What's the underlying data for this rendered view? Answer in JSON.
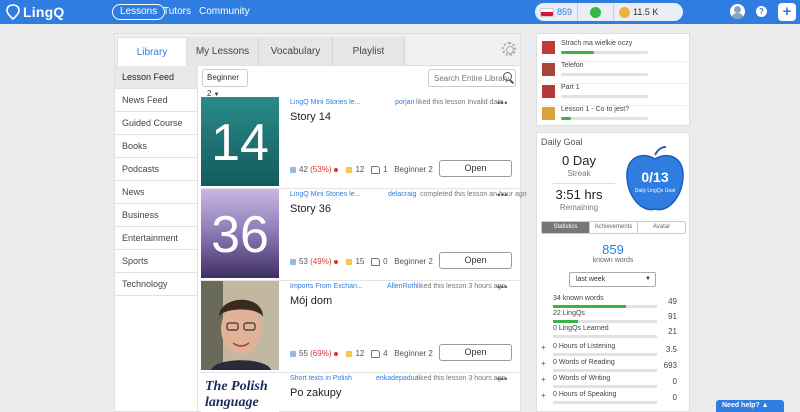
{
  "app": {
    "logo": "LingQ"
  },
  "nav": {
    "lessons": "Lessons",
    "tutors": "Tutors",
    "community": "Community"
  },
  "header_stats": {
    "known_words": "859",
    "coins": "11.5 K"
  },
  "help": {
    "question": "?",
    "need_help": "Need help? ▲"
  },
  "tabs": [
    "Library",
    "My Lessons",
    "Vocabulary",
    "Playlist"
  ],
  "sidebar": [
    "Lesson Feed",
    "News Feed",
    "Guided Course",
    "Books",
    "Podcasts",
    "News",
    "Business",
    "Entertainment",
    "Sports",
    "Technology"
  ],
  "filter": {
    "level": "Beginner 2"
  },
  "search": {
    "placeholder": "Search Entire Library"
  },
  "lessons": [
    {
      "number": "14",
      "collection": "LingQ Mini Stories le...",
      "user": "porjan",
      "action": "liked this lesson  Invalid date",
      "title": "Story 14",
      "words": "42",
      "pct": "(53%)",
      "lingqs": "12",
      "likes": "1",
      "level": "Beginner 2",
      "open": "Open"
    },
    {
      "number": "36",
      "collection": "LingQ Mini Stories le...",
      "user": "delacraig",
      "action": "completed this lesson  an hour ago",
      "title": "Story 36",
      "words": "53",
      "pct": "(49%)",
      "lingqs": "15",
      "likes": "0",
      "level": "Beginner 2",
      "open": "Open"
    },
    {
      "number": "",
      "collection": "Imports From Exchan...",
      "user": "AllenRoth",
      "action": "liked this lesson  3 hours ago",
      "title": "Mój dom",
      "words": "55",
      "pct": "(69%)",
      "lingqs": "12",
      "likes": "4",
      "level": "Beginner 2",
      "open": "Open"
    },
    {
      "number": "",
      "thumb_text_1": "The Polish",
      "thumb_text_2": "language",
      "collection": "Short texts in Polish",
      "user": "enkadepadua",
      "action": "liked this lesson  3 hours ago",
      "title": "Po zakupy"
    }
  ],
  "recent": [
    {
      "title": "Strach ma wielkie oczy",
      "progress": 0.38
    },
    {
      "title": "Telefon",
      "progress": 0.0
    },
    {
      "title": "Part 1",
      "progress": 0.0
    },
    {
      "title": "Lesson 1 - Co to jest?",
      "progress": 0.12
    }
  ],
  "goal": {
    "title": "Daily Goal",
    "days": "0 Day",
    "streak": "Streak",
    "hours": "3:51 hrs",
    "remaining": "Remaining",
    "lingqs": "0/13",
    "lingqs_label": "Daily LingQs Goal"
  },
  "stat_tabs": [
    "Statistics",
    "Achievements",
    "Avatar"
  ],
  "known": {
    "number": "859",
    "label": "known words"
  },
  "period": "last week",
  "stats": [
    {
      "label": "34 known words",
      "value": "49",
      "progress": 0.7,
      "plus": false
    },
    {
      "label": "22 LingQs",
      "value": "91",
      "progress": 0.24,
      "plus": false
    },
    {
      "label": "0 LingQs Learned",
      "value": "21",
      "progress": 0.0,
      "plus": false
    },
    {
      "label": "0 Hours of Listening",
      "value": "3.5",
      "progress": 0.0,
      "plus": true
    },
    {
      "label": "0 Words of Reading",
      "value": "693",
      "progress": 0.0,
      "plus": true
    },
    {
      "label": "0 Words of Writing",
      "value": "0",
      "progress": 0.0,
      "plus": true
    },
    {
      "label": "0 Hours of Speaking",
      "value": "0",
      "progress": 0.0,
      "plus": true
    }
  ],
  "colors": {
    "brand": "#2f7de1",
    "green": "#3bb34a",
    "thumb14": "#1f6e6e",
    "thumb36": "#8a7ab6"
  }
}
